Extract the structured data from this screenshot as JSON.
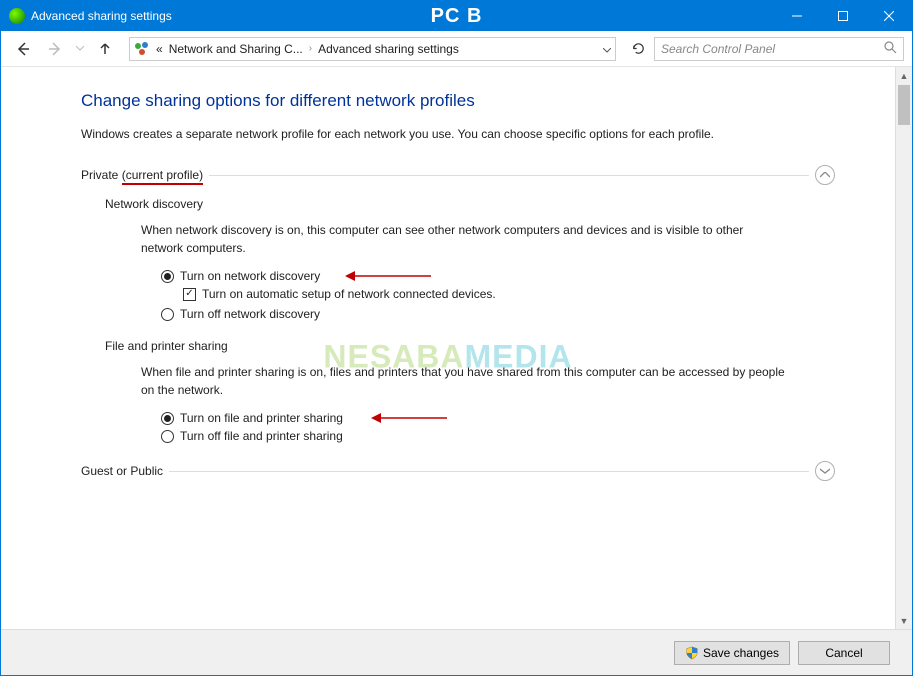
{
  "titlebar": {
    "window_title": "Advanced sharing settings",
    "pc_label": "PC B"
  },
  "nav": {
    "breadcrumb_prefix": "«",
    "breadcrumb_1": "Network and Sharing C...",
    "breadcrumb_2": "Advanced sharing settings",
    "search_placeholder": "Search Control Panel"
  },
  "page": {
    "heading": "Change sharing options for different network profiles",
    "intro": "Windows creates a separate network profile for each network you use. You can choose specific options for each profile."
  },
  "sections": {
    "private": {
      "label": "Private",
      "current_suffix": "(current profile)",
      "network_discovery": {
        "title": "Network discovery",
        "desc": "When network discovery is on, this computer can see other network computers and devices and is visible to other network computers.",
        "opt_on": "Turn on network discovery",
        "opt_auto": "Turn on automatic setup of network connected devices.",
        "opt_off": "Turn off network discovery"
      },
      "file_printer": {
        "title": "File and printer sharing",
        "desc": "When file and printer sharing is on, files and printers that you have shared from this computer can be accessed by people on the network.",
        "opt_on": "Turn on file and printer sharing",
        "opt_off": "Turn off file and printer sharing"
      }
    },
    "guest": {
      "label": "Guest or Public"
    }
  },
  "footer": {
    "save": "Save changes",
    "cancel": "Cancel"
  },
  "watermark": {
    "part1": "NESABA",
    "part2": "MEDIA"
  }
}
